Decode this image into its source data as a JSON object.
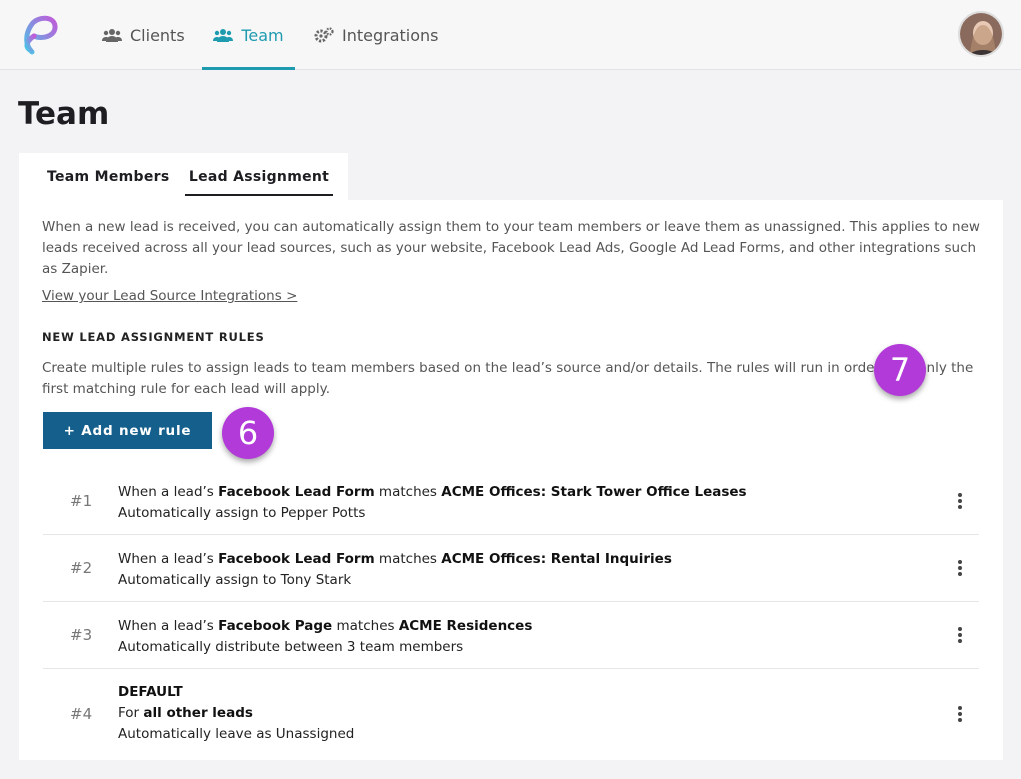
{
  "nav": {
    "clients_label": "Clients",
    "team_label": "Team",
    "integrations_label": "Integrations",
    "active": "Team",
    "accent_color": "#1f9bb0"
  },
  "page": {
    "title": "Team"
  },
  "tabs": {
    "members": "Team Members",
    "lead_assignment": "Lead Assignment",
    "active": "Lead Assignment"
  },
  "intro": {
    "text": "When a new lead is received, you can automatically assign them to your team members or leave them as unassigned. This applies to new leads received across all your lead sources, such as your website, Facebook Lead Ads, Google Ad Lead Forms, and other integrations such as Zapier.",
    "link": "View your Lead Source Integrations >"
  },
  "rules_section": {
    "heading": "NEW LEAD ASSIGNMENT RULES",
    "description": "Create multiple rules to assign leads to team members based on the lead’s source and/or details. The rules will run in order, and only the first matching rule for each lead will apply.",
    "add_button": "+ Add new rule"
  },
  "badges": {
    "six": "6",
    "seven": "7",
    "color": "#b13ad8"
  },
  "rules": [
    {
      "num": "#1",
      "prefix": "When a lead’s ",
      "field": "Facebook Lead Form",
      "mid": " matches ",
      "value": "ACME Offices: Stark Tower Office Leases",
      "action": "Automatically assign to Pepper Potts"
    },
    {
      "num": "#2",
      "prefix": "When a lead’s ",
      "field": "Facebook Lead Form",
      "mid": " matches ",
      "value": "ACME Offices: Rental Inquiries",
      "action": "Automatically assign to Tony Stark"
    },
    {
      "num": "#3",
      "prefix": "When a lead’s ",
      "field": "Facebook Page",
      "mid": " matches ",
      "value": "ACME Residences",
      "action": "Automatically distribute between 3 team members"
    },
    {
      "num": "#4",
      "default_label": "DEFAULT",
      "for_prefix": "For ",
      "for_bold": "all other leads",
      "action": "Automatically leave as Unassigned"
    }
  ]
}
